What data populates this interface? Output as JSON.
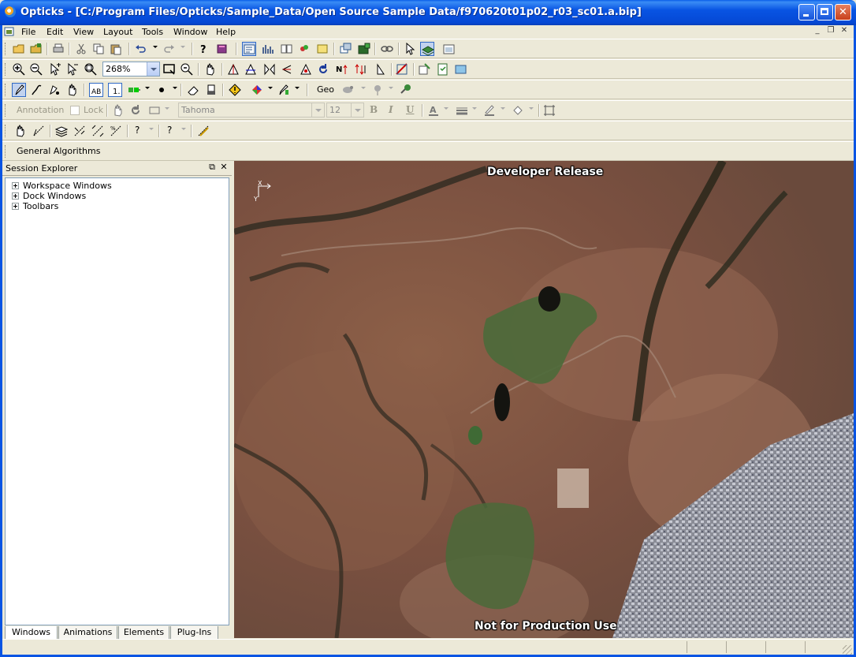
{
  "window": {
    "title": "Opticks - [C:/Program Files/Opticks/Sample_Data/Open Source Sample Data/f970620t01p02_r03_sc01.a.bip]",
    "controls": [
      "minimize-icon",
      "maximize-icon",
      "close-icon"
    ],
    "title_color": "#0854e3"
  },
  "menu": {
    "items": [
      "File",
      "Edit",
      "View",
      "Layout",
      "Tools",
      "Window",
      "Help"
    ],
    "mdi_controls": [
      "minimize-icon",
      "restore-icon",
      "close-icon"
    ]
  },
  "toolbars": {
    "standard": {
      "icons": [
        "open-icon",
        "save-icon",
        "print-icon",
        "cut-icon",
        "copy-icon",
        "paste-icon",
        "undo-icon",
        "redo-icon",
        "help-icon",
        "book-icon",
        "session-explorer-icon",
        "histogram-icon",
        "layers-icon",
        "animation-icon",
        "scroll-icon",
        "windows-icon",
        "link-icon",
        "pointer-icon",
        "layer-icon",
        "properties-icon"
      ]
    },
    "view": {
      "zoom_value": "268%",
      "icons": [
        "zoom-in-icon",
        "zoom-out-icon",
        "zoom-point-in-icon",
        "zoom-point-out-icon",
        "zoom-rect-icon",
        "zoom-fit-icon",
        "zoom-mag-icon",
        "pan-icon",
        "rotate-icon",
        "flip-icon",
        "north-up-icon",
        "sensor-up-icon",
        "reset-icon",
        "chip-icon"
      ]
    },
    "annotation": {
      "icons": [
        "pencil-icon",
        "brush-icon",
        "fill-icon",
        "pan-icon",
        "text-ab-icon",
        "number-icon",
        "color-band-icon",
        "bullet-icon",
        "eraser-icon",
        "stamp-icon",
        "warning-icon",
        "color-palette-icon",
        "pen-icon"
      ],
      "geo_label": "Geo"
    },
    "annotation_format": {
      "annotation_label": "Annotation",
      "lock_label": "Lock",
      "font_name": "Tahoma",
      "font_size": "12",
      "bold": "B",
      "italic": "I",
      "underline": "U"
    },
    "measurement": {
      "help_label_1": "?",
      "help_label_2": "?"
    },
    "algorithms": {
      "label": "General Algorithms"
    }
  },
  "session_explorer": {
    "title": "Session Explorer",
    "tree": [
      {
        "label": "Workspace Windows"
      },
      {
        "label": "Dock Windows"
      },
      {
        "label": "Toolbars"
      }
    ],
    "tabs": [
      {
        "label": "Windows",
        "selected": true
      },
      {
        "label": "Animations",
        "selected": false
      },
      {
        "label": "Elements",
        "selected": false
      },
      {
        "label": "Plug-Ins",
        "selected": false
      }
    ]
  },
  "image_view": {
    "watermark_top": "Developer Release",
    "watermark_bottom": "Not for Production Use",
    "axis_x": "X",
    "axis_y": "Y"
  }
}
